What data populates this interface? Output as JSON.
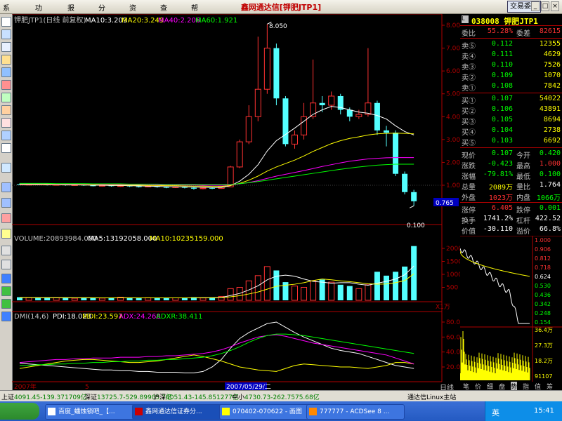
{
  "window": {
    "title": "鑫网通达信[钾肥JTP1]",
    "trade_button": "交易委托",
    "min": "_",
    "max": "□",
    "close": "×"
  },
  "menu": [
    "系统(S)",
    "功能(F)",
    "报价(B)",
    "分析(A)",
    "资讯(I)",
    "查看(V)",
    "帮助(H)"
  ],
  "price_panel": {
    "legend": {
      "name": "钾肥JTP1(日线 前复权)",
      "ma10": "MA10:3.209",
      "ma20": "MA20:3.249",
      "ma40": "MA40:2.206",
      "ma60": "MA60:1.921"
    },
    "high_label": "8.050",
    "low_label": "0.100",
    "cur_price_tag": "0.765",
    "y_ticks": [
      "8.00",
      "7.00",
      "6.00",
      "5.00",
      "4.00",
      "3.00",
      "2.00",
      "1.00"
    ]
  },
  "volume_panel": {
    "legend": {
      "vol": "VOLUME:20893984.000",
      "ma5": "MA5:13192058.000",
      "ma10": "MA10:10235159.000"
    },
    "y_ticks": [
      "2000",
      "1500",
      "1000",
      "500"
    ],
    "unit": "X1万"
  },
  "dmi_panel": {
    "legend": {
      "name": "DMI(14,6)",
      "pdi": "PDI:18.023",
      "mdi": "MDI:23.597",
      "adx": "ADX:24.268",
      "adxr": "ADXR:38.411"
    },
    "y_ticks": [
      "80.00",
      "60.00",
      "40.00",
      "20.00"
    ]
  },
  "x_axis": {
    "left_label": "2007年",
    "mid_label": "5",
    "date_label": "2007/05/29/二"
  },
  "colors": {
    "up": "#ff3232",
    "down": "#54ffff",
    "ma10": "#ffffff",
    "ma20": "#ffff00",
    "ma40": "#ff00ff",
    "ma60": "#00ff00",
    "axis": "#b00000"
  },
  "chart_data": {
    "type": "candlestick",
    "candles": [
      {
        "o": 1.05,
        "c": 1.02,
        "h": 1.08,
        "l": 1.0
      },
      {
        "o": 1.02,
        "c": 1.04,
        "h": 1.06,
        "l": 1.0
      },
      {
        "o": 1.04,
        "c": 1.03,
        "h": 1.06,
        "l": 1.01
      },
      {
        "o": 1.03,
        "c": 1.01,
        "h": 1.05,
        "l": 0.99
      },
      {
        "o": 1.01,
        "c": 1.03,
        "h": 1.05,
        "l": 0.99
      },
      {
        "o": 1.03,
        "c": 1.0,
        "h": 1.04,
        "l": 0.98
      },
      {
        "o": 1.0,
        "c": 1.02,
        "h": 1.04,
        "l": 0.98
      },
      {
        "o": 1.02,
        "c": 0.99,
        "h": 1.03,
        "l": 0.97
      },
      {
        "o": 0.99,
        "c": 0.97,
        "h": 1.01,
        "l": 0.95
      },
      {
        "o": 0.97,
        "c": 0.99,
        "h": 1.01,
        "l": 0.95
      },
      {
        "o": 0.99,
        "c": 0.96,
        "h": 1.0,
        "l": 0.94
      },
      {
        "o": 0.96,
        "c": 0.98,
        "h": 1.0,
        "l": 0.93
      },
      {
        "o": 0.98,
        "c": 0.95,
        "h": 0.99,
        "l": 0.92
      },
      {
        "o": 0.95,
        "c": 0.93,
        "h": 0.97,
        "l": 0.9
      },
      {
        "o": 0.93,
        "c": 0.96,
        "h": 0.98,
        "l": 0.91
      },
      {
        "o": 0.96,
        "c": 0.92,
        "h": 0.97,
        "l": 0.89
      },
      {
        "o": 0.92,
        "c": 0.9,
        "h": 0.94,
        "l": 0.87
      },
      {
        "o": 0.9,
        "c": 0.93,
        "h": 0.95,
        "l": 0.88
      },
      {
        "o": 0.93,
        "c": 0.89,
        "h": 0.94,
        "l": 0.86
      },
      {
        "o": 0.89,
        "c": 0.85,
        "h": 0.91,
        "l": 0.8
      },
      {
        "o": 0.85,
        "c": 0.88,
        "h": 0.92,
        "l": 0.82
      },
      {
        "o": 0.88,
        "c": 0.86,
        "h": 0.9,
        "l": 0.83
      },
      {
        "o": 0.86,
        "c": 0.93,
        "h": 0.96,
        "l": 0.84
      },
      {
        "o": 0.93,
        "c": 1.8,
        "h": 1.85,
        "l": 0.92
      },
      {
        "o": 1.8,
        "c": 2.9,
        "h": 3.0,
        "l": 1.75
      },
      {
        "o": 2.9,
        "c": 4.0,
        "h": 4.5,
        "l": 2.8
      },
      {
        "o": 4.0,
        "c": 5.2,
        "h": 7.5,
        "l": 3.8
      },
      {
        "o": 5.2,
        "c": 7.0,
        "h": 8.05,
        "l": 5.0
      },
      {
        "o": 7.0,
        "c": 4.8,
        "h": 7.2,
        "l": 4.5
      },
      {
        "o": 4.8,
        "c": 2.8,
        "h": 4.9,
        "l": 2.7
      },
      {
        "o": 2.8,
        "c": 3.2,
        "h": 3.4,
        "l": 2.6
      },
      {
        "o": 3.2,
        "c": 4.0,
        "h": 4.6,
        "l": 3.0
      },
      {
        "o": 4.0,
        "c": 4.6,
        "h": 6.5,
        "l": 3.9
      },
      {
        "o": 4.6,
        "c": 4.5,
        "h": 4.9,
        "l": 4.2
      },
      {
        "o": 4.5,
        "c": 4.9,
        "h": 5.1,
        "l": 4.3
      },
      {
        "o": 4.9,
        "c": 4.3,
        "h": 5.0,
        "l": 4.1
      },
      {
        "o": 4.3,
        "c": 4.0,
        "h": 4.4,
        "l": 3.8
      },
      {
        "o": 4.0,
        "c": 4.1,
        "h": 4.3,
        "l": 3.9
      },
      {
        "o": 4.1,
        "c": 4.6,
        "h": 7.0,
        "l": 4.0
      },
      {
        "o": 4.6,
        "c": 3.4,
        "h": 4.7,
        "l": 3.2
      },
      {
        "o": 3.4,
        "c": 3.3,
        "h": 3.6,
        "l": 2.7
      },
      {
        "o": 3.3,
        "c": 1.5,
        "h": 3.4,
        "l": 1.4
      },
      {
        "o": 1.5,
        "c": 0.7,
        "h": 1.6,
        "l": 0.6
      },
      {
        "o": 0.7,
        "c": 0.3,
        "h": 0.8,
        "l": 0.1
      }
    ],
    "ma10": [
      1.02,
      1.02,
      1.02,
      1.02,
      1.02,
      1.01,
      1.01,
      1.01,
      1.0,
      1.0,
      0.99,
      0.99,
      0.98,
      0.97,
      0.96,
      0.95,
      0.94,
      0.93,
      0.93,
      0.92,
      0.91,
      0.9,
      0.9,
      0.98,
      1.18,
      1.48,
      1.9,
      2.5,
      2.95,
      3.22,
      3.5,
      3.8,
      4.1,
      4.3,
      4.45,
      4.4,
      4.3,
      4.2,
      4.15,
      4.05,
      3.9,
      3.6,
      3.35,
      3.2
    ],
    "ma20": [
      1.04,
      1.04,
      1.04,
      1.03,
      1.03,
      1.03,
      1.03,
      1.02,
      1.02,
      1.02,
      1.01,
      1.01,
      1.0,
      1.0,
      0.99,
      0.99,
      0.98,
      0.98,
      0.97,
      0.96,
      0.96,
      0.95,
      0.95,
      0.99,
      1.08,
      1.22,
      1.4,
      1.62,
      1.8,
      1.95,
      2.1,
      2.28,
      2.48,
      2.65,
      2.82,
      2.95,
      3.05,
      3.12,
      3.2,
      3.25,
      3.27,
      3.28,
      3.27,
      3.25
    ],
    "ma40": [
      1.06,
      1.06,
      1.06,
      1.06,
      1.05,
      1.05,
      1.05,
      1.05,
      1.05,
      1.04,
      1.04,
      1.04,
      1.03,
      1.03,
      1.03,
      1.02,
      1.02,
      1.02,
      1.01,
      1.01,
      1.0,
      1.0,
      1.0,
      1.02,
      1.06,
      1.12,
      1.2,
      1.3,
      1.4,
      1.48,
      1.56,
      1.64,
      1.73,
      1.82,
      1.9,
      1.98,
      2.05,
      2.1,
      2.15,
      2.18,
      2.2,
      2.21,
      2.21,
      2.21
    ],
    "ma60": [
      1.08,
      1.08,
      1.08,
      1.08,
      1.07,
      1.07,
      1.07,
      1.07,
      1.06,
      1.06,
      1.06,
      1.06,
      1.05,
      1.05,
      1.05,
      1.05,
      1.04,
      1.04,
      1.04,
      1.04,
      1.03,
      1.03,
      1.03,
      1.04,
      1.07,
      1.11,
      1.16,
      1.22,
      1.28,
      1.34,
      1.4,
      1.46,
      1.52,
      1.58,
      1.64,
      1.7,
      1.75,
      1.8,
      1.84,
      1.88,
      1.9,
      1.92,
      1.92,
      1.92
    ],
    "volume": [
      120,
      100,
      90,
      110,
      95,
      100,
      80,
      110,
      90,
      85,
      100,
      120,
      90,
      80,
      100,
      90,
      85,
      95,
      100,
      120,
      90,
      110,
      150,
      450,
      500,
      750,
      950,
      1300,
      1150,
      700,
      550,
      500,
      750,
      800,
      700,
      600,
      550,
      450,
      600,
      1100,
      950,
      1100,
      1300,
      2090
    ],
    "vol_ma5": [
      110,
      108,
      105,
      103,
      100,
      100,
      98,
      97,
      96,
      95,
      96,
      97,
      98,
      96,
      95,
      94,
      93,
      94,
      96,
      98,
      100,
      102,
      110,
      185,
      265,
      400,
      560,
      790,
      930,
      970,
      930,
      820,
      730,
      700,
      660,
      680,
      680,
      620,
      580,
      660,
      730,
      820,
      980,
      1320
    ],
    "vol_ma10": [
      105,
      104,
      103,
      102,
      101,
      100,
      99,
      98,
      97,
      96,
      96,
      96,
      96,
      96,
      95,
      95,
      95,
      95,
      95,
      96,
      97,
      98,
      102,
      135,
      180,
      245,
      320,
      430,
      540,
      580,
      620,
      680,
      760,
      820,
      790,
      750,
      720,
      680,
      640,
      620,
      630,
      680,
      760,
      1020
    ],
    "pdi": [
      25,
      24,
      23,
      22,
      21,
      20,
      19,
      18,
      17,
      16,
      16,
      15,
      15,
      14,
      14,
      13,
      13,
      13,
      12,
      12,
      14,
      20,
      30,
      45,
      58,
      66,
      72,
      78,
      80,
      73,
      66,
      60,
      55,
      50,
      45,
      42,
      40,
      38,
      34,
      30,
      26,
      22,
      20,
      18
    ],
    "mdi": [
      18,
      20,
      22,
      24,
      26,
      28,
      29,
      30,
      30,
      29,
      28,
      27,
      26,
      26,
      27,
      28,
      30,
      32,
      34,
      36,
      34,
      31,
      28,
      24,
      20,
      18,
      16,
      15,
      14,
      18,
      22,
      24,
      23,
      22,
      21,
      20,
      20,
      19,
      18,
      20,
      22,
      26,
      26,
      24
    ],
    "adx": [
      26,
      27,
      28,
      29,
      30,
      30,
      31,
      31,
      32,
      32,
      32,
      33,
      33,
      33,
      34,
      34,
      35,
      35,
      36,
      37,
      38,
      40,
      43,
      47,
      52,
      56,
      60,
      62,
      63,
      61,
      58,
      55,
      52,
      50,
      48,
      46,
      44,
      42,
      40,
      38,
      36,
      32,
      28,
      24
    ],
    "adxr": [
      22,
      22,
      23,
      23,
      24,
      24,
      25,
      25,
      26,
      26,
      27,
      27,
      28,
      28,
      29,
      29,
      30,
      30,
      31,
      32,
      33,
      35,
      38,
      42,
      47,
      53,
      58,
      62,
      64,
      64,
      63,
      62,
      60,
      58,
      56,
      54,
      52,
      50,
      48,
      46,
      44,
      42,
      40,
      38
    ]
  },
  "quote": {
    "code": "038008",
    "name": "钾肥JTP1",
    "rows_top": [
      {
        "l1": "委比",
        "v1": "55.28%",
        "l2": "委差",
        "v2": "82615",
        "c1": "#ff3232",
        "c2": "#ff3232"
      }
    ],
    "sell": [
      {
        "l": "卖⑤",
        "p": "0.112",
        "q": "12355"
      },
      {
        "l": "卖④",
        "p": "0.111",
        "q": "4629"
      },
      {
        "l": "卖③",
        "p": "0.110",
        "q": "7526"
      },
      {
        "l": "卖②",
        "p": "0.109",
        "q": "1070"
      },
      {
        "l": "卖①",
        "p": "0.108",
        "q": "7842"
      }
    ],
    "buy": [
      {
        "l": "买①",
        "p": "0.107",
        "q": "54022"
      },
      {
        "l": "买②",
        "p": "0.106",
        "q": "43891"
      },
      {
        "l": "买③",
        "p": "0.105",
        "q": "8694"
      },
      {
        "l": "买④",
        "p": "0.104",
        "q": "2738"
      },
      {
        "l": "买⑤",
        "p": "0.103",
        "q": "6692"
      }
    ],
    "stats": [
      {
        "l1": "现价",
        "v1": "0.107",
        "c1": "#00ff00",
        "l2": "今开",
        "v2": "0.420",
        "c2": "#00ff00"
      },
      {
        "l1": "涨跌",
        "v1": "-0.423",
        "c1": "#00ff00",
        "l2": "最高",
        "v2": "1.000",
        "c2": "#ff3232"
      },
      {
        "l1": "涨幅",
        "v1": "-79.81%",
        "c1": "#00ff00",
        "l2": "最低",
        "v2": "0.100",
        "c2": "#00ff00"
      },
      {
        "l1": "总量",
        "v1": "2089万",
        "c1": "#ffff00",
        "l2": "量比",
        "v2": "1.764",
        "c2": "#ffffff"
      },
      {
        "l1": "外盘",
        "v1": "1023万",
        "c1": "#ff3232",
        "l2": "内盘",
        "v2": "1066万",
        "c2": "#00ff00"
      }
    ],
    "limits": [
      {
        "l1": "涨停",
        "v1": "6.405",
        "c1": "#ff3232",
        "l2": "跌停",
        "v2": "0.001",
        "c2": "#00ff00"
      },
      {
        "l1": "换手",
        "v1": "1741.2%",
        "c1": "#ffffff",
        "l2": "杠杆",
        "v2": "422.52",
        "c2": "#ffffff"
      },
      {
        "l1": "价值",
        "v1": "-30.110",
        "c1": "#ffffff",
        "l2": "溢价",
        "v2": "66.8%",
        "c2": "#ffffff"
      }
    ]
  },
  "mini_chart": {
    "price_ticks": [
      "1.000",
      "0.906",
      "0.812",
      "0.718",
      "0.624",
      "0.530",
      "0.436",
      "0.342",
      "0.248",
      "0.154"
    ],
    "vol_ticks": [
      "36.4万",
      "27.3万",
      "18.2万",
      "91107"
    ],
    "tabs": [
      "笔",
      "价",
      "细",
      "盘",
      "势",
      "指",
      "值",
      "筹"
    ],
    "active_tab": "势"
  },
  "right_labels": {
    "daily": "日线"
  },
  "statusbar": [
    {
      "label": "上证",
      "value": "4091.45-139.371709亿",
      "color": "#008000"
    },
    {
      "label": "深证",
      "value": "13725.7-529.89905.7亿",
      "color": "#008000"
    },
    {
      "label": "沪深",
      "value": "4051.43-145.851277亿",
      "color": "#008000"
    },
    {
      "label": "中小",
      "value": "4730.73-262.7575.68亿",
      "color": "#008000"
    },
    {
      "label": "",
      "value": "通达信Linux主站",
      "color": "#000000"
    }
  ],
  "taskbar": {
    "tasks": [
      "百度_蟠烛锁吧_【...",
      "鑫网通达信证券分...",
      "070402-070622 - 画图",
      "777777 - ACDSee 8 ..."
    ],
    "ime": "英",
    "clock": "15:41"
  }
}
